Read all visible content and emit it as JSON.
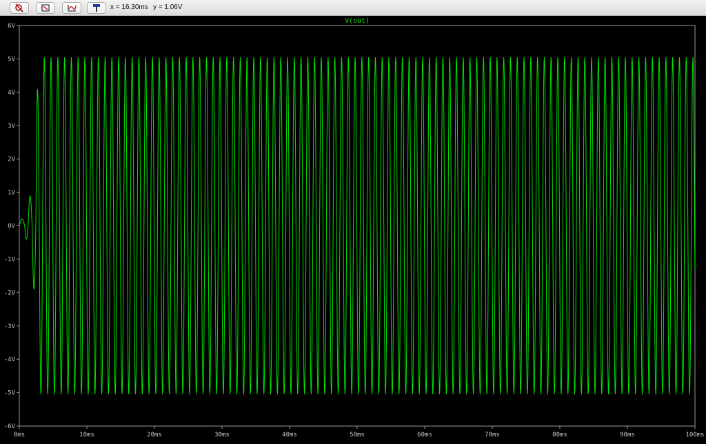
{
  "toolbar": {
    "buttons": [
      {
        "icon": "zoom-cancel-icon"
      },
      {
        "icon": "zoom-extents-icon"
      },
      {
        "icon": "autorange-icon"
      },
      {
        "icon": "probe-icon"
      }
    ],
    "readout_x": "x = 16.30ms",
    "readout_y": "y = 1.06V"
  },
  "colors": {
    "background": "#000000",
    "trace": "#00e600",
    "axis": "#9a9a9a",
    "label": "#c8c8c8"
  },
  "chart_data": {
    "type": "line",
    "title": "V(out)",
    "xlabel": "",
    "ylabel": "",
    "xlim": [
      0,
      100
    ],
    "ylim": [
      -6,
      6
    ],
    "x_ticks": [
      "0ms",
      "10ms",
      "20ms",
      "30ms",
      "40ms",
      "50ms",
      "60ms",
      "70ms",
      "80ms",
      "90ms",
      "100ms"
    ],
    "y_ticks": [
      "6V",
      "5V",
      "4V",
      "3V",
      "2V",
      "1V",
      "0V",
      "-1V",
      "-2V",
      "-3V",
      "-4V",
      "-5V",
      "-6V"
    ],
    "grid": false,
    "series": [
      {
        "name": "V(out)",
        "x_unit": "ms",
        "y_unit": "V",
        "frequency_khz": 1.0,
        "startup_peaks": [
          [
            0.6,
            0.2
          ],
          [
            1.0,
            -0.4
          ],
          [
            1.6,
            0.9
          ],
          [
            2.2,
            -1.9
          ],
          [
            2.7,
            4.1
          ],
          [
            3.2,
            -5.05
          ]
        ],
        "steady_amplitude": 5.05,
        "steady_start_ms": 3.2,
        "end_ms": 100
      }
    ]
  }
}
